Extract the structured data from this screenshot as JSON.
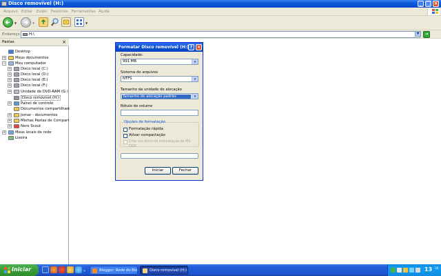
{
  "window": {
    "title": "Disco removível (H:)",
    "buttons": {
      "minimize": "_",
      "maximize": "□",
      "close": "×"
    }
  },
  "menu": [
    "Arquivo",
    "Editar",
    "Exibir",
    "Favoritos",
    "Ferramentas",
    "Ajuda"
  ],
  "toolbar": {
    "icons": [
      "back-icon",
      "forward-icon",
      "up-folder-icon",
      "search-icon",
      "folders-icon",
      "views-icon"
    ]
  },
  "address": {
    "label": "Endereço",
    "value": "H:\\"
  },
  "folders_pane": {
    "title": "Pastas",
    "close_glyph": "×",
    "tree": [
      {
        "label": "Desktop",
        "expander": "",
        "icon": "desktop-icon"
      },
      {
        "label": "Meus documentos",
        "expander": "+",
        "icon": "folder-icon"
      },
      {
        "label": "Meu computador",
        "expander": "−",
        "icon": "computer-icon"
      },
      {
        "label": "Disco local (C:)",
        "expander": "+",
        "icon": "drive-icon"
      },
      {
        "label": "Disco local (D:)",
        "expander": "+",
        "icon": "drive-icon"
      },
      {
        "label": "Disco local (E:)",
        "expander": "+",
        "icon": "drive-icon"
      },
      {
        "label": "Disco local (F:)",
        "expander": "+",
        "icon": "drive-icon"
      },
      {
        "label": "Unidade de DVD-RAM (G:)",
        "expander": "+",
        "icon": "dvd-icon"
      },
      {
        "label": "Disco removível (H:)",
        "expander": "",
        "icon": "removable-drive-icon",
        "selected": true
      },
      {
        "label": "Painel de controle",
        "expander": "+",
        "icon": "control-panel-icon"
      },
      {
        "label": "Documentos compartilhados",
        "expander": "",
        "icon": "folder-icon"
      },
      {
        "label": "Jomar - documentos",
        "expander": "+",
        "icon": "folder-icon"
      },
      {
        "label": "Minhas Pastas de Compartilh",
        "expander": "+",
        "icon": "folder-icon"
      },
      {
        "label": "Nero Scout",
        "expander": "+",
        "icon": "nero-icon"
      },
      {
        "label": "Meus locais de rede",
        "expander": "+",
        "icon": "network-icon"
      },
      {
        "label": "Lixeira",
        "expander": "",
        "icon": "recycle-bin-icon"
      }
    ]
  },
  "dialog": {
    "title": "Formatar Disco removível (H:)",
    "help": "?",
    "close": "×",
    "capacity_label": "Capacidade:",
    "capacity_value": "991 MB",
    "filesystem_label": "Sistema de arquivos",
    "filesystem_value": "NTFS",
    "allocation_label": "Tamanho da unidade de alocação",
    "allocation_value": "Tamanho de alocação padrão",
    "volume_label": "Rótulo do volume",
    "volume_value": "",
    "options_title": "Opções de formatação",
    "option_quick": "Formatação rápida",
    "option_compress": "Ativar compactação",
    "option_msdos": "Criar um disco de inicialização do MS-DOS",
    "progress": 0,
    "start_button": "Iniciar",
    "close_button": "Fechar",
    "combo_arrow": "▼"
  },
  "taskbar": {
    "start_label": "Iniciar",
    "tasks": [
      {
        "label": "Blogger: Rede do Blo...",
        "icon": "browser-icon"
      },
      {
        "label": "Disco removível (H:)",
        "icon": "folder-window-icon"
      }
    ],
    "clock": "13",
    "clock_sub": "10"
  },
  "colors": {
    "xp_blue": "#0a5adc",
    "dialog_border": "#0831d9",
    "selection": "#316ac5",
    "start_green": "#379c37",
    "close_red": "#e0502d",
    "chrome_bg": "#ece9d8"
  }
}
